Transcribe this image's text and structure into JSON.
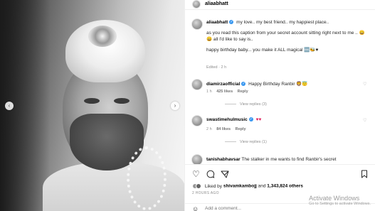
{
  "post": {
    "username": "aliaabhatt",
    "caption_line1": "my love.. my best friend.. my happiest place..",
    "caption_line2": "as you read this caption from your secret account sitting right next to me .. 😄😄 all I'd like to say is..",
    "caption_line3": "happy birthday baby... you make it ALL magical 🆒🐝♥",
    "caption_meta": "Edited · 2 h"
  },
  "comments": [
    {
      "username": "diamirzaofficial",
      "text": "Happy Birthday Ranbir 🦁😇",
      "time": "1 h",
      "likes": "425 likes",
      "reply_label": "Reply",
      "view_replies": "View replies (3)"
    },
    {
      "username": "swastimehulmusic",
      "text": "♥♥",
      "time": "2 h",
      "likes": "84 likes",
      "reply_label": "Reply",
      "view_replies": "View replies (1)"
    },
    {
      "username": "tanishabhavsar",
      "text": "The stalker in me wants to find Ranbir's secret"
    }
  ],
  "actions": {
    "liked_by_prefix": "Liked by",
    "liked_by_user": "shivamkambojj",
    "liked_by_and": "and",
    "liked_by_count": "1,343,824 others",
    "time_ago": "2 HOURS AGO",
    "add_comment_placeholder": "Add a comment..."
  },
  "watermark": {
    "line1": "Activate Windows",
    "line2": "Go to Settings to activate Windows."
  },
  "icons": {
    "heart": "heart-icon",
    "comment": "comment-icon",
    "share": "share-icon",
    "bookmark": "bookmark-icon",
    "emoji": "emoji-icon",
    "prev": "chevron-left-icon",
    "next": "chevron-right-icon",
    "verified": "verified-badge-icon"
  }
}
